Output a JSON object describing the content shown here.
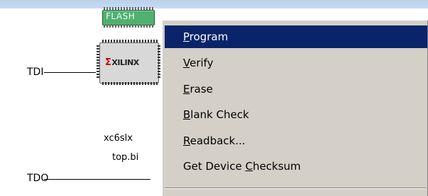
{
  "chain": {
    "tdi_label": "TDI",
    "tdo_label": "TDO"
  },
  "flash_chip": {
    "label": "FLASH"
  },
  "fpga_chip": {
    "logo_text": "XILINX"
  },
  "device": {
    "name": "xc6slx",
    "file": "top.bi"
  },
  "context_menu": {
    "items": [
      {
        "prefix": "",
        "accel": "P",
        "suffix": "rogram",
        "selected": true
      },
      {
        "prefix": "",
        "accel": "V",
        "suffix": "erify"
      },
      {
        "prefix": "",
        "accel": "E",
        "suffix": "rase"
      },
      {
        "prefix": "",
        "accel": "B",
        "suffix": "lank Check"
      },
      {
        "prefix": "",
        "accel": "R",
        "suffix": "eadback..."
      },
      {
        "prefix": "Get Device ",
        "accel": "C",
        "suffix": "hecksum"
      }
    ]
  },
  "colors": {
    "menu_bg": "#d4d0c8",
    "menu_selected": "#0a246a",
    "flash_green": "#4fb070"
  }
}
